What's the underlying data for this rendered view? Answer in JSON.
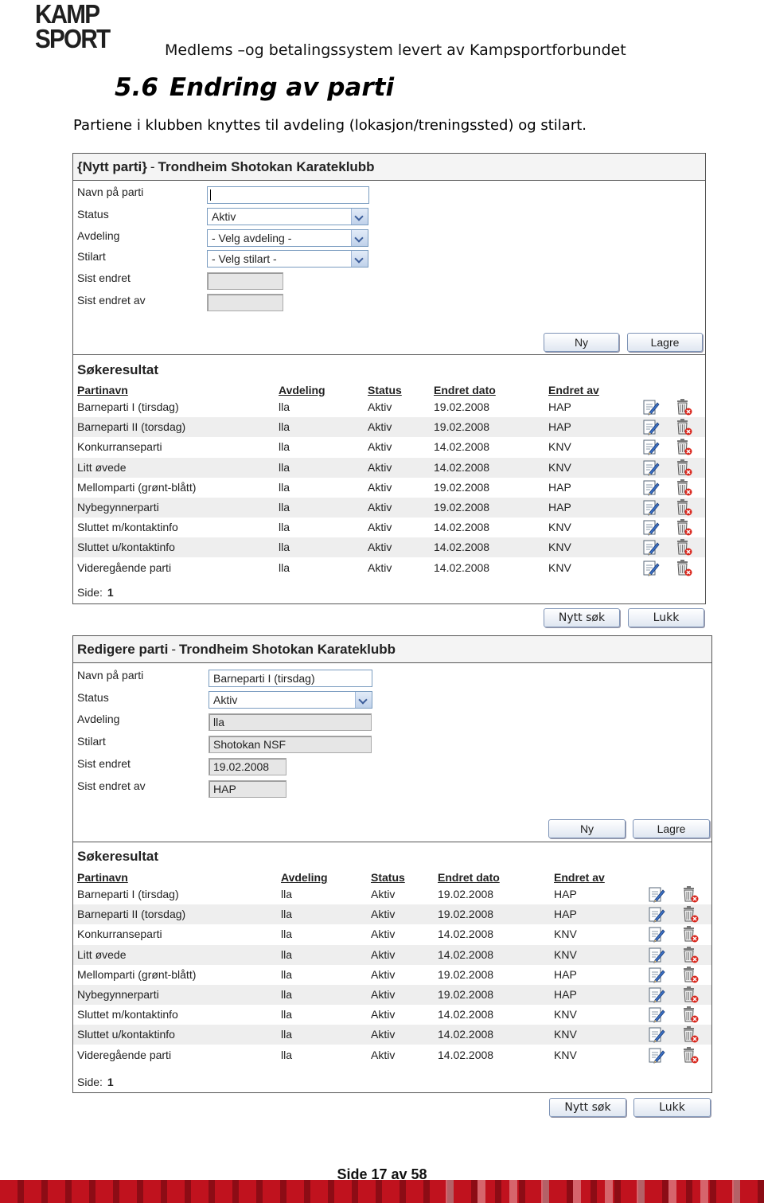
{
  "logo": {
    "line1": "KAMP",
    "line2": "SPORT"
  },
  "doc_header": "Medlems –og betalingssystem levert av Kampsportforbundet",
  "section": {
    "number": "5.6",
    "title": "Endring av parti"
  },
  "intro": "Partiene i klubben knyttes til avdeling (lokasjon/treningssted) og stilart.",
  "panel1": {
    "title_prefix": "{Nytt parti}",
    "title_sep": "-",
    "title_club": "Trondheim Shotokan Karateklubb",
    "labels": [
      "Navn på parti",
      "Status",
      "Avdeling",
      "Stilart",
      "Sist endret",
      "Sist endret av"
    ],
    "name_value": "",
    "status_value": "Aktiv",
    "avdeling_value": "- Velg avdeling -",
    "stilart_value": "- Velg stilart -",
    "sist_endret": "",
    "sist_endret_av": "",
    "btn_new": "Ny",
    "btn_save": "Lagre"
  },
  "panel2": {
    "title_prefix": "Redigere parti",
    "title_sep": "-",
    "title_club": "Trondheim Shotokan Karateklubb",
    "labels": [
      "Navn på parti",
      "Status",
      "Avdeling",
      "Stilart",
      "Sist endret",
      "Sist endret av"
    ],
    "name_value": "Barneparti I (tirsdag)",
    "status_value": "Aktiv",
    "avdeling_value": "lla",
    "stilart_value": "Shotokan NSF",
    "sist_endret": "19.02.2008",
    "sist_endret_av": "HAP",
    "btn_new": "Ny",
    "btn_save": "Lagre"
  },
  "results": {
    "title": "Søkeresultat",
    "columns": [
      "Partinavn",
      "Avdeling",
      "Status",
      "Endret dato",
      "Endret av"
    ],
    "rows": [
      [
        "Barneparti I (tirsdag)",
        "lla",
        "Aktiv",
        "19.02.2008",
        "HAP"
      ],
      [
        "Barneparti II (torsdag)",
        "lla",
        "Aktiv",
        "19.02.2008",
        "HAP"
      ],
      [
        "Konkurranseparti",
        "lla",
        "Aktiv",
        "14.02.2008",
        "KNV"
      ],
      [
        "Litt øvede",
        "lla",
        "Aktiv",
        "14.02.2008",
        "KNV"
      ],
      [
        "Mellomparti (grønt-blått)",
        "lla",
        "Aktiv",
        "19.02.2008",
        "HAP"
      ],
      [
        "Nybegynnerparti",
        "lla",
        "Aktiv",
        "19.02.2008",
        "HAP"
      ],
      [
        "Sluttet m/kontaktinfo",
        "lla",
        "Aktiv",
        "14.02.2008",
        "KNV"
      ],
      [
        "Sluttet u/kontaktinfo",
        "lla",
        "Aktiv",
        "14.02.2008",
        "KNV"
      ],
      [
        "Videregående parti",
        "lla",
        "Aktiv",
        "14.02.2008",
        "KNV"
      ]
    ],
    "side_label": "Side:",
    "side_value": "1",
    "btn_search": "Nytt søk",
    "btn_close": "Lukk"
  },
  "footer": "Side 17 av 58",
  "icons": {
    "edit": "edit-icon",
    "delete": "delete-icon"
  },
  "colors": {
    "accent_border": "#7a9cc0",
    "footer_band": "#c0121e"
  }
}
